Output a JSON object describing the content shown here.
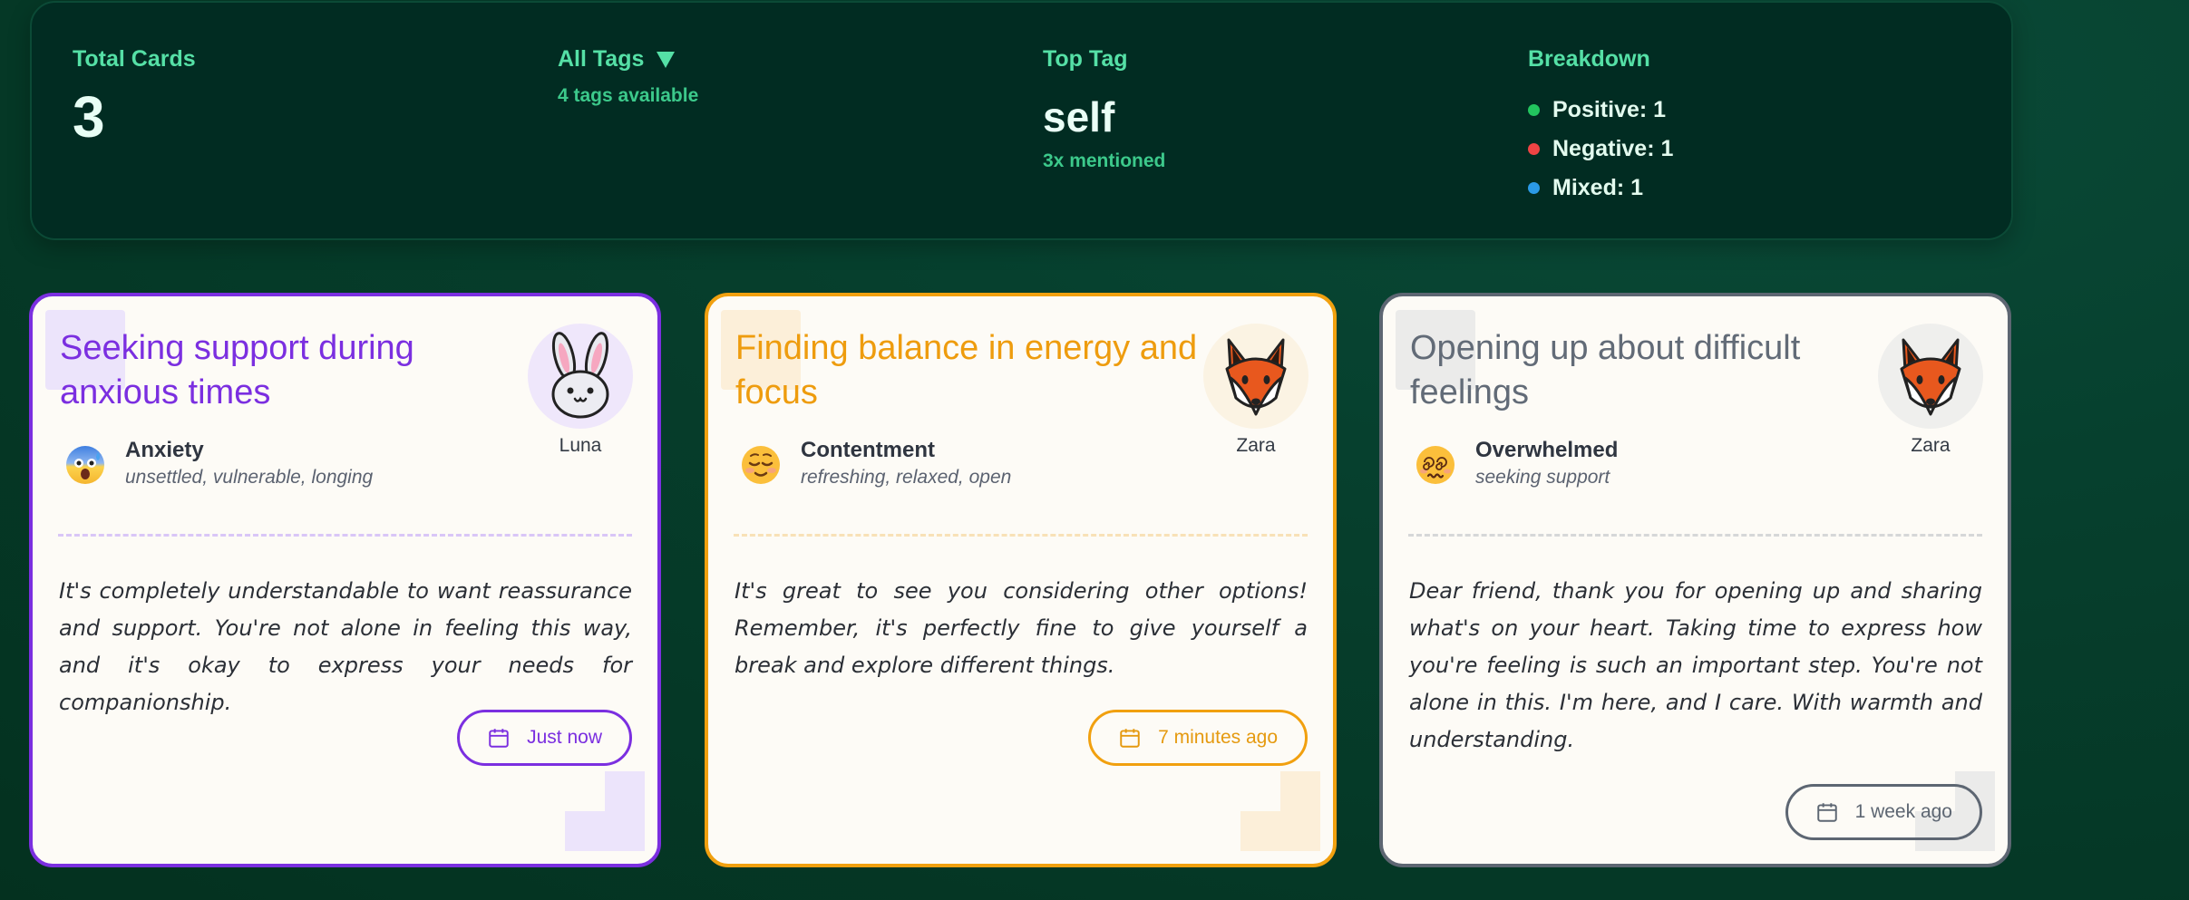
{
  "stats": {
    "total_label": "Total Cards",
    "total_value": "3",
    "tags_label": "All Tags",
    "tags_sub": "4 tags available",
    "top_label": "Top Tag",
    "top_value": "self",
    "top_sub": "3x mentioned",
    "breakdown_label": "Breakdown",
    "breakdown": [
      {
        "label": "Positive: 1",
        "color": "#22c55e"
      },
      {
        "label": "Negative: 1",
        "color": "#ef4444"
      },
      {
        "label": "Mixed: 1",
        "color": "#2b9ae6"
      }
    ]
  },
  "cards": [
    {
      "title": "Seeking support during anxious times",
      "accent": "#7b2fe0",
      "avatar_icon": "rabbit-icon",
      "avatar_name": "Luna",
      "mood_icon": "anxious-face-icon",
      "mood": "Anxiety",
      "mood_sub": "unsettled, vulnerable, longing",
      "message": "It's completely understandable to want reassurance and support. You're not alone in feeling this way, and it's okay to express your needs for companionship.",
      "time": "Just now"
    },
    {
      "title": "Finding balance in energy and focus",
      "accent": "#f1a00f",
      "avatar_icon": "fox-icon",
      "avatar_name": "Zara",
      "mood_icon": "relieved-face-icon",
      "mood": "Contentment",
      "mood_sub": "refreshing, relaxed, open",
      "message": "It's great to see you considering other options! Remember, it's perfectly fine to give yourself a break and explore different things.",
      "time": "7 minutes ago"
    },
    {
      "title": "Opening up about difficult feelings",
      "accent": "#5d6672",
      "avatar_icon": "fox-icon",
      "avatar_name": "Zara",
      "mood_icon": "dizzy-face-icon",
      "mood": "Overwhelmed",
      "mood_sub": "seeking support",
      "message": "Dear friend, thank you for opening up and sharing what's on your heart. Taking time to express how you're feeling is such an important step. You're not alone in this. I'm here, and I care. With warmth and understanding.",
      "time": "1 week ago"
    }
  ]
}
